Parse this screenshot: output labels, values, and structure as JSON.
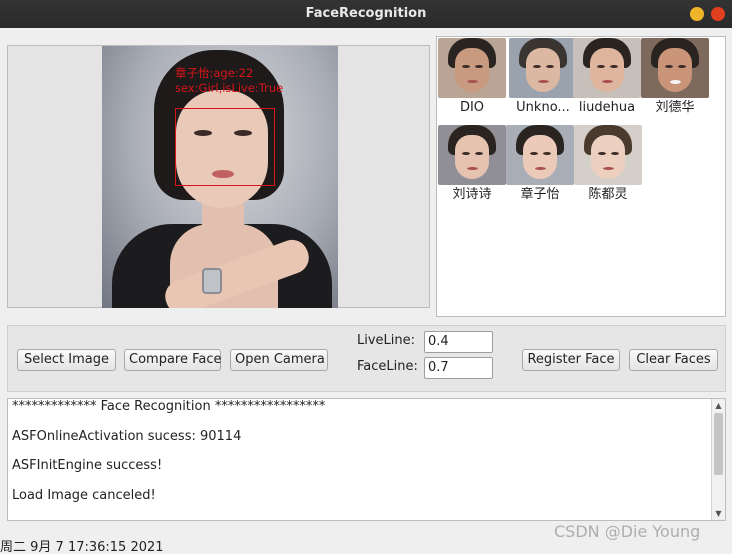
{
  "window": {
    "title": "FaceRecognition"
  },
  "image_panel": {
    "detection_label_line1": "章子怡:age:22",
    "detection_label_line2": "sex:Girl,isLive:True"
  },
  "gallery": {
    "faces": [
      {
        "name": "DIO"
      },
      {
        "name": "Unkno..."
      },
      {
        "name": "liudehua"
      },
      {
        "name": "刘德华"
      },
      {
        "name": "刘诗诗"
      },
      {
        "name": "章子怡"
      },
      {
        "name": "陈都灵"
      }
    ]
  },
  "controls": {
    "select_image": "Select Image",
    "compare_face": "Compare Face",
    "open_camera": "Open Camera",
    "liveline_label": "LiveLine:",
    "liveline_value": "0.4",
    "faceline_label": "FaceLine:",
    "faceline_value": "0.7",
    "register_face": "Register Face",
    "clear_faces": "Clear Faces"
  },
  "log": {
    "lines": [
      "************* Face Recognition *****************",
      "ASFOnlineActivation sucess: 90114",
      "ASFInitEngine success!",
      "Load Image canceled!"
    ]
  },
  "status": {
    "datetime": "周二 9月 7 17:36:15 2021"
  },
  "watermark": {
    "text": "CSDN @Die Young"
  },
  "colors": {
    "detection": "#d8141a",
    "titlebar": "#2e2e2e",
    "minimize": "#f0b429",
    "close": "#e1401e"
  }
}
